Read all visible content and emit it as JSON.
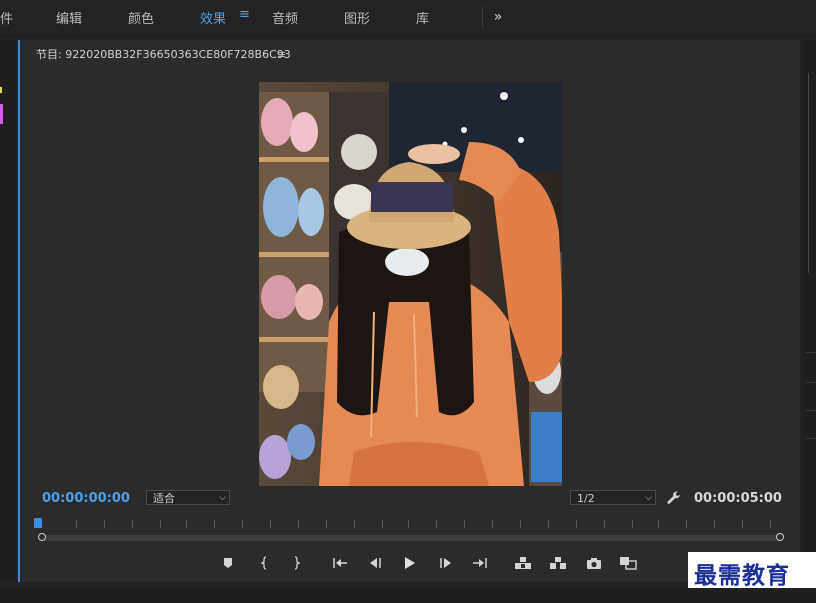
{
  "workspace_tabs": [
    {
      "label": "件"
    },
    {
      "label": "编辑"
    },
    {
      "label": "颜色"
    },
    {
      "label": "效果"
    },
    {
      "label": "音频"
    },
    {
      "label": "图形"
    },
    {
      "label": "库"
    }
  ],
  "active_tab": "效果",
  "more_tabs_icon": "chevrons-right-icon",
  "program_monitor": {
    "title": "节目: 922020BB32F36650363CE80F728B6C93",
    "menu_icon": "hamburger-icon",
    "timecode_current": "00:00:00:00",
    "zoom_select": "适合",
    "resolution_select": "1/2",
    "settings_icon": "wrench-icon",
    "timecode_duration": "00:00:05:00",
    "playhead_position": 0
  },
  "transport": [
    {
      "name": "add-marker",
      "icon": "marker-icon"
    },
    {
      "name": "mark-in",
      "icon": "mark-in-icon"
    },
    {
      "name": "mark-out",
      "icon": "mark-out-icon"
    },
    {
      "name": "go-to-in",
      "icon": "go-to-in-icon"
    },
    {
      "name": "step-back",
      "icon": "step-back-icon"
    },
    {
      "name": "play",
      "icon": "play-icon"
    },
    {
      "name": "step-forward",
      "icon": "step-forward-icon"
    },
    {
      "name": "go-to-out",
      "icon": "go-to-out-icon"
    },
    {
      "name": "lift",
      "icon": "lift-icon"
    },
    {
      "name": "extract",
      "icon": "extract-icon"
    },
    {
      "name": "export-frame",
      "icon": "camera-icon"
    },
    {
      "name": "comparison-view",
      "icon": "comparison-view-icon"
    }
  ],
  "watermark": "最需教育",
  "colors": {
    "accent": "#4ea0e8",
    "panel_bg": "#2b2b2b",
    "app_bg": "#232323"
  }
}
